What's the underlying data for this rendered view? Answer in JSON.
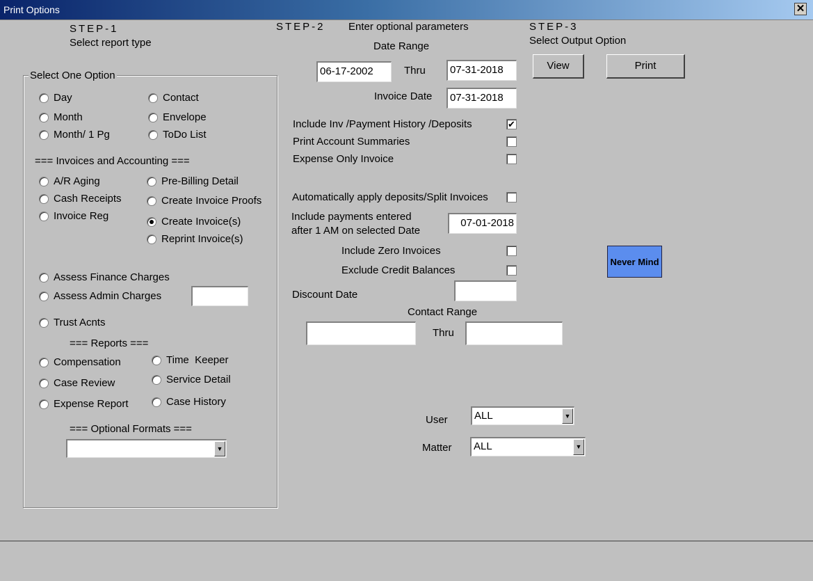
{
  "window": {
    "title": "Print Options",
    "close_glyph": "✕"
  },
  "step1": {
    "heading": "STEP-1",
    "subheading": "Select report type",
    "group_label": "Select One Option",
    "options_basic": [
      {
        "label": "Day"
      },
      {
        "label": "Contact"
      },
      {
        "label": "Month"
      },
      {
        "label": "Envelope"
      },
      {
        "label": "Month/ 1 Pg"
      },
      {
        "label": "ToDo List"
      }
    ],
    "invoices_heading": "=== Invoices and Accounting ===",
    "options_invoices": [
      {
        "label": "A/R Aging"
      },
      {
        "label": "Pre-Billing Detail"
      },
      {
        "label": "Cash Receipts"
      },
      {
        "label": "Create Invoice Proofs"
      },
      {
        "label": "Invoice Reg"
      },
      {
        "label": "Create Invoice(s)",
        "selected": true
      },
      {
        "label": "Reprint Invoice(s)"
      }
    ],
    "options_charges": [
      {
        "label": "Assess Finance Charges"
      },
      {
        "label": "Assess Admin Charges"
      },
      {
        "label": "Trust Acnts"
      }
    ],
    "admin_charges_value": "",
    "reports_heading": "=== Reports ===",
    "options_reports": [
      {
        "label": "Compensation"
      },
      {
        "label": "Time  Keeper"
      },
      {
        "label": "Case Review"
      },
      {
        "label": "Service Detail"
      },
      {
        "label": "Expense Report"
      },
      {
        "label": "Case History"
      }
    ],
    "formats_heading": "=== Optional Formats ===",
    "formats_value": ""
  },
  "step2": {
    "heading": "STEP-2",
    "subheading": "Enter optional parameters",
    "date_range_label": "Date Range",
    "date_from": "06-17-2002",
    "thru_label": "Thru",
    "date_to": "07-31-2018",
    "invoice_date_label": "Invoice Date",
    "invoice_date": "07-31-2018",
    "include_history_label": "Include Inv /Payment History /Deposits",
    "include_history_checked": "✔",
    "account_summaries_label": "Print Account Summaries",
    "expense_only_label": "Expense Only Invoice",
    "auto_apply_label": "Automatically apply deposits/Split Invoices",
    "payments_label_line1": "Include payments entered",
    "payments_label_line2": "after 1 AM on selected Date",
    "payments_date": "07-01-2018",
    "zero_invoices_label": "Include Zero Invoices",
    "credit_balances_label": "Exclude Credit Balances",
    "discount_date_label": "Discount Date",
    "discount_date": "",
    "contact_range_label": "Contact Range",
    "contact_from": "",
    "contact_thru_label": "Thru",
    "contact_to": "",
    "user_label": "User",
    "user_value": "ALL",
    "matter_label": "Matter",
    "matter_value": "ALL"
  },
  "step3": {
    "heading": "STEP-3",
    "subheading": "Select Output Option",
    "view_label": "View",
    "print_label": "Print",
    "never_mind_label": "Never Mind",
    "never_mind_color": "#5b8dee"
  }
}
